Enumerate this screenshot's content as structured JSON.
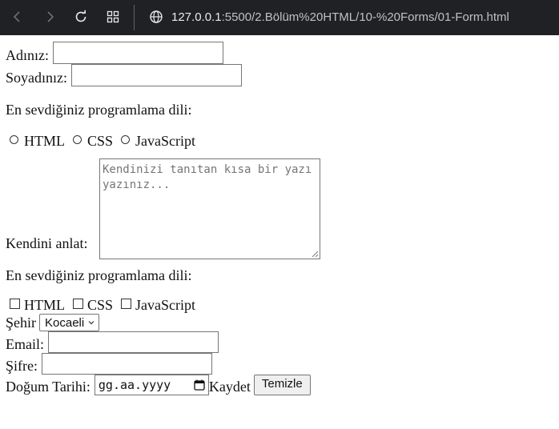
{
  "browser": {
    "url_host": "127.0.0.1",
    "url_path": ":5500/2.Bölüm%20HTML/10-%20Forms/01-Form.html"
  },
  "form": {
    "name_label": "Adınız:",
    "surname_label": "Soyadınız:",
    "language_question_1": "En sevdiğiniz programlama dili:",
    "radio_options": [
      "HTML",
      "CSS",
      "JavaScript"
    ],
    "about_label": "Kendini anlat:",
    "about_placeholder": "Kendinizi tanıtan kısa bir yazı yazınız...",
    "language_question_2": "En sevdiğiniz programlama dili:",
    "checkbox_options": [
      "HTML",
      "CSS",
      "JavaScript"
    ],
    "city_label": "Şehir",
    "city_value": "Kocaeli",
    "email_label": "Email:",
    "password_label": "Şifre:",
    "birthdate_label": "Doğum Tarihi:",
    "birthdate_placeholder": "gg.aa.yyyy",
    "submit_text": "Kaydet",
    "reset_label": "Temizle"
  }
}
